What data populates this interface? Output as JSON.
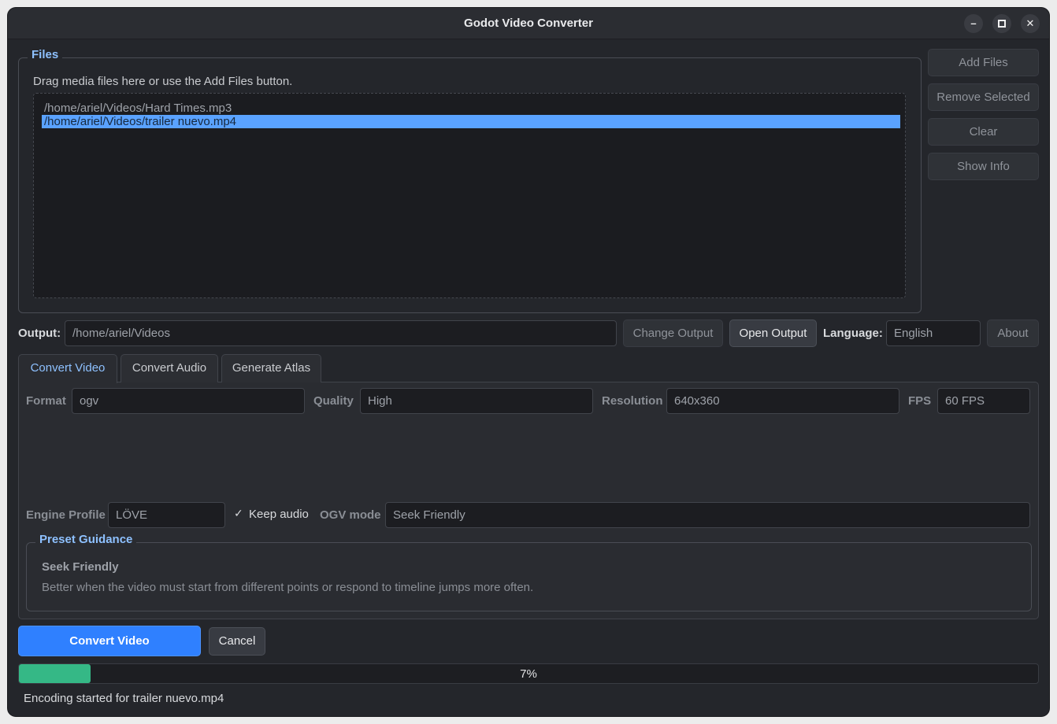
{
  "window": {
    "title": "Godot Video Converter",
    "controls": {
      "minimize": "–",
      "maximize": "□",
      "close": "✕"
    }
  },
  "files": {
    "legend": "Files",
    "hint": "Drag media files here or use the Add Files button.",
    "items": [
      {
        "path": "/home/ariel/Videos/Hard Times.mp3",
        "selected": false
      },
      {
        "path": "/home/ariel/Videos/trailer nuevo.mp4",
        "selected": true
      }
    ]
  },
  "side_buttons": {
    "add_files": "Add Files",
    "remove_selected": "Remove Selected",
    "clear": "Clear",
    "show_info": "Show Info"
  },
  "output": {
    "label": "Output:",
    "path": "/home/ariel/Videos",
    "change_label": "Change Output",
    "open_label": "Open Output",
    "language_label": "Language:",
    "language_value": "English",
    "about_label": "About"
  },
  "tabs": [
    {
      "label": "Convert Video",
      "selected": true
    },
    {
      "label": "Convert Audio",
      "selected": false
    },
    {
      "label": "Generate Atlas",
      "selected": false
    }
  ],
  "video": {
    "format_label": "Format",
    "format_value": "ogv",
    "quality_label": "Quality",
    "quality_value": "High",
    "resolution_label": "Resolution",
    "resolution_value": "640x360",
    "fps_label": "FPS",
    "fps_value": "60 FPS",
    "engine_label": "Engine Profile",
    "engine_value": "LÖVE",
    "keep_audio_label": "Keep audio",
    "keep_audio_checked": true,
    "checkmark": "✓",
    "ogv_mode_label": "OGV mode",
    "ogv_mode_value": "Seek Friendly"
  },
  "guidance": {
    "legend": "Preset Guidance",
    "title": "Seek Friendly",
    "text": "Better when the video must start from different points or respond to timeline jumps more often."
  },
  "actions": {
    "convert_label": "Convert Video",
    "cancel_label": "Cancel"
  },
  "progress": {
    "value": 0.07,
    "text": "7%"
  },
  "status": {
    "text": "Encoding started for trailer nuevo.mp4"
  },
  "colors": {
    "accent": "#2f80ff",
    "progress_fill": "#35b886",
    "selection": "#5aa2ff",
    "legend": "#8ec1ff",
    "background": "#24262b"
  }
}
